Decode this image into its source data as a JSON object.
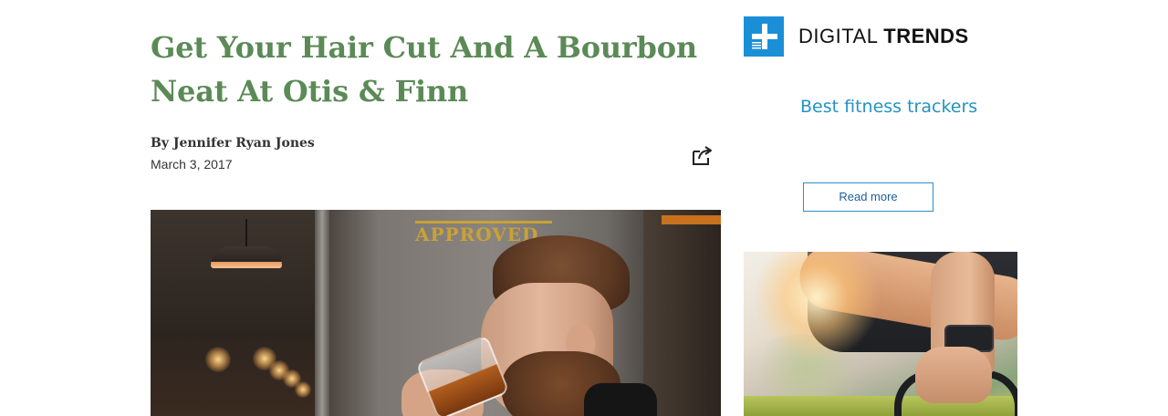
{
  "article": {
    "title": "Get Your Hair Cut And A Bourbon Neat At Otis & Finn",
    "byline": "By Jennifer Ryan Jones",
    "date": "March 3, 2017",
    "hero_sign": "APPROVED",
    "share_icon": "share-icon"
  },
  "sidebar_ad": {
    "brand_light": "DIGITAL",
    "brand_bold": "TRENDS",
    "brand_icon": "plus-icon",
    "headline": "Best fitness trackers",
    "cta_label": "Read more",
    "accent_color": "#1a8fd8",
    "headline_color": "#2393c4"
  },
  "colors": {
    "headline": "#5b8a57",
    "body_text": "#333333"
  }
}
